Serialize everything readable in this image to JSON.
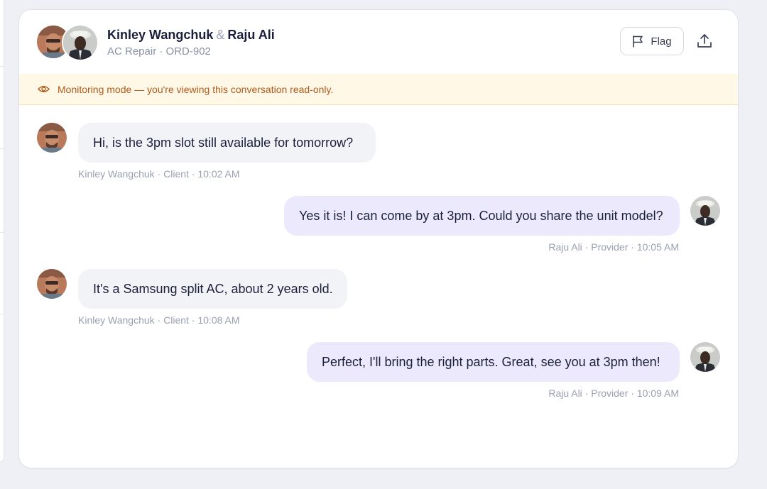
{
  "header": {
    "client_name": "Kinley Wangchuk",
    "separator": "&",
    "provider_name": "Raju Ali",
    "service": "AC Repair",
    "dot": "·",
    "order_id": "ORD-902",
    "flag_label": "Flag"
  },
  "banner": {
    "text": "Monitoring mode — you're viewing this conversation read-only."
  },
  "messages": [
    {
      "sender": "client",
      "text": "Hi, is the 3pm slot still available for tomorrow?",
      "name": "Kinley Wangchuk",
      "role": "Client",
      "time": "10:02 AM"
    },
    {
      "sender": "provider",
      "text": "Yes it is! I can come by at 3pm. Could you share the unit model?",
      "name": "Raju Ali",
      "role": "Provider",
      "time": "10:05 AM"
    },
    {
      "sender": "client",
      "text": "It's a Samsung split AC, about 2 years old.",
      "name": "Kinley Wangchuk",
      "role": "Client",
      "time": "10:08 AM"
    },
    {
      "sender": "provider",
      "text": "Perfect, I'll bring the right parts. Great, see you at 3pm then!",
      "name": "Raju Ali",
      "role": "Provider",
      "time": "10:09 AM"
    }
  ],
  "colors": {
    "client_bubble": "#f1f3f7",
    "provider_bubble": "#ece9fd",
    "banner_bg": "#fff8e6",
    "banner_text": "#b05a1b",
    "title_text": "#1b1f3b",
    "meta_text": "#9aa0b2"
  },
  "icons": {
    "flag": "flag-icon",
    "share": "share-upload-icon",
    "banner": "eye-icon"
  }
}
